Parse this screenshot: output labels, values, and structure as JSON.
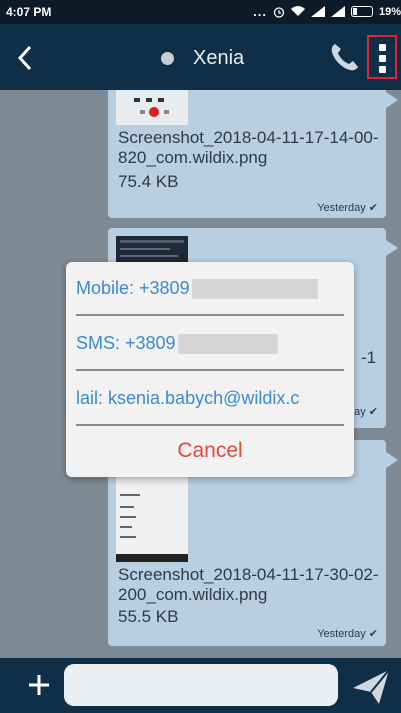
{
  "status_bar": {
    "time": "4:07 PM",
    "dots": "...",
    "battery": "19%"
  },
  "header": {
    "contact_name": "Xenia"
  },
  "messages": [
    {
      "filename": "Screenshot_2018-04-11-17-14-00-820_com.wildix.png",
      "size": "75.4 KB",
      "time": "Yesterday"
    },
    {
      "partial_text": "-1",
      "time": "ay"
    },
    {
      "filename": "Screenshot_2018-04-11-17-30-02-200_com.wildix.png",
      "size": "55.5 KB",
      "time": "Yesterday"
    }
  ],
  "dialog": {
    "mobile_label": "Mobile: +3809",
    "sms_label": "SMS: +3809",
    "mail_label": "lail: ksenia.babych@wildix.c",
    "cancel_label": "Cancel"
  },
  "composer": {
    "placeholder": ""
  },
  "colors": {
    "header": "#0f2e48",
    "bubble": "#b8cfe2",
    "link": "#3a8ad6",
    "cancel": "#e0483d",
    "highlight": "#e0242b"
  }
}
